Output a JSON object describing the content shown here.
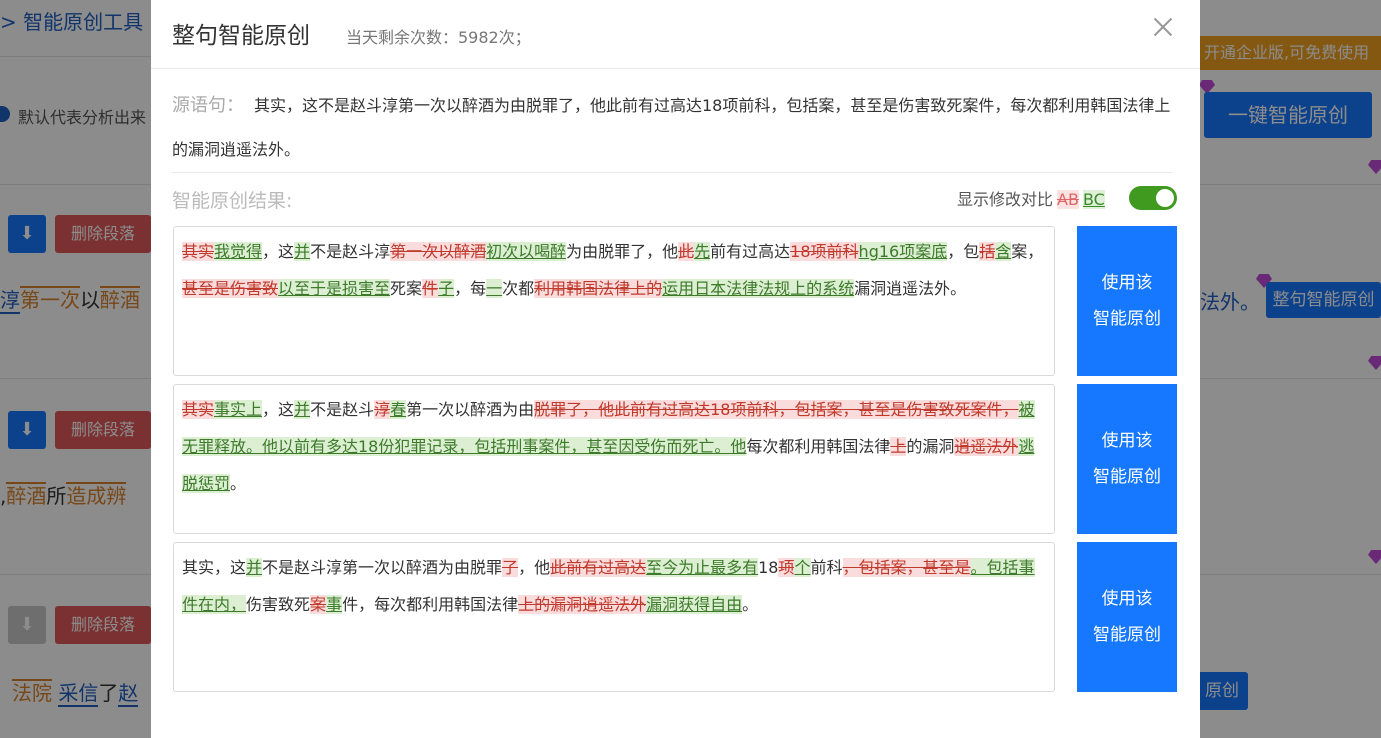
{
  "background": {
    "breadcrumb": "> 智能原创工具",
    "default_analysis": "默认代表分析出来",
    "promo_banner": "开通企业版,可免费使用",
    "one_click_button": "一键智能原创",
    "delete_paragraph": "删除段落",
    "whole_sentence_button": "整句智能原创",
    "row1_words": [
      "淳",
      "第一次",
      "以",
      "醉酒"
    ],
    "row1_right": "法外。",
    "row2_words": [
      ",",
      "醉酒",
      "所",
      "造成",
      "辨"
    ],
    "row3_words": [
      "法院",
      "采信",
      "了",
      "赵"
    ],
    "row3_button": "原创",
    "arrow_icon": "down-arrow-icon",
    "colors": {
      "primary": "#1677ff",
      "danger": "#e05a5a",
      "promo": "#f0a020"
    }
  },
  "modal": {
    "title": "整句智能原创",
    "remaining_label": "当天剩余次数：5982次；",
    "source_label": "源语句：",
    "source_text": "其实，这不是赵斗淳第一次以醉酒为由脱罪了，他此前有过高达18项前科，包括案，甚至是伤害致死案件，每次都利用韩国法律上的漏洞逍遥法外。",
    "result_label": "智能原创结果:",
    "toggle_label": "显示修改对比",
    "toggle_ab": "AB",
    "toggle_bc": "BC",
    "toggle_on": true,
    "use_button_line1": "使用该",
    "use_button_line2": "智能原创",
    "results": [
      [
        {
          "t": "其实",
          "k": "d"
        },
        {
          "t": "我觉得",
          "k": "a"
        },
        {
          "t": "，这",
          "k": ""
        },
        {
          "t": "并",
          "k": "a"
        },
        {
          "t": "不是赵斗淳",
          "k": ""
        },
        {
          "t": "第一次以醉酒",
          "k": "d"
        },
        {
          "t": "初次以喝醉",
          "k": "a"
        },
        {
          "t": "为由脱罪了，他",
          "k": ""
        },
        {
          "t": "此",
          "k": "d"
        },
        {
          "t": "先",
          "k": "a"
        },
        {
          "t": "前有过高达",
          "k": ""
        },
        {
          "t": "18项前科",
          "k": "d"
        },
        {
          "t": "hg16项案底",
          "k": "a"
        },
        {
          "t": "，包",
          "k": ""
        },
        {
          "t": "括",
          "k": "d"
        },
        {
          "t": "含",
          "k": "a"
        },
        {
          "t": "案，",
          "k": ""
        },
        {
          "t": "甚至是伤害致",
          "k": "d"
        },
        {
          "t": "以至于是损害至",
          "k": "a"
        },
        {
          "t": "死案",
          "k": ""
        },
        {
          "t": "件",
          "k": "d"
        },
        {
          "t": "子",
          "k": "a"
        },
        {
          "t": "，每",
          "k": ""
        },
        {
          "t": "一",
          "k": "a"
        },
        {
          "t": "次都",
          "k": ""
        },
        {
          "t": "利用韩国法律上的",
          "k": "d"
        },
        {
          "t": "运用日本法律法规上的系统",
          "k": "a"
        },
        {
          "t": "漏洞逍遥法外。",
          "k": ""
        }
      ],
      [
        {
          "t": "其实",
          "k": "d"
        },
        {
          "t": "事实上",
          "k": "a"
        },
        {
          "t": "，这",
          "k": ""
        },
        {
          "t": "并",
          "k": "a"
        },
        {
          "t": "不是赵斗",
          "k": ""
        },
        {
          "t": "淳",
          "k": "d"
        },
        {
          "t": "春",
          "k": "a"
        },
        {
          "t": "第一次以醉酒为由",
          "k": ""
        },
        {
          "t": "脱罪了，他此前有过高达18项前科，包括案，甚至是伤害致死案件，",
          "k": "d"
        },
        {
          "t": "被无罪释放。他以前有多达18份犯罪记录，包括刑事案件，甚至因受伤而死亡。他",
          "k": "a"
        },
        {
          "t": "每次都利用韩国法律",
          "k": ""
        },
        {
          "t": "上",
          "k": "d"
        },
        {
          "t": "的漏洞",
          "k": ""
        },
        {
          "t": "逍遥法外",
          "k": "d"
        },
        {
          "t": "逃脱惩罚",
          "k": "a"
        },
        {
          "t": "。",
          "k": ""
        }
      ],
      [
        {
          "t": "其实，这",
          "k": ""
        },
        {
          "t": "并",
          "k": "a"
        },
        {
          "t": "不是赵斗淳第一次以醉酒为由脱罪",
          "k": ""
        },
        {
          "t": "了",
          "k": "d"
        },
        {
          "t": "，他",
          "k": ""
        },
        {
          "t": "此前有过高达",
          "k": "d"
        },
        {
          "t": "至今为止最多有",
          "k": "a"
        },
        {
          "t": "18",
          "k": ""
        },
        {
          "t": "项",
          "k": "d"
        },
        {
          "t": "个",
          "k": "a"
        },
        {
          "t": "前科",
          "k": ""
        },
        {
          "t": "，包括案，甚至是",
          "k": "d"
        },
        {
          "t": "。包括事件在内，",
          "k": "a"
        },
        {
          "t": "伤害致死",
          "k": ""
        },
        {
          "t": "案",
          "k": "d"
        },
        {
          "t": "事",
          "k": "a"
        },
        {
          "t": "件，每次都利用韩国法律",
          "k": ""
        },
        {
          "t": "上的漏洞逍遥法外",
          "k": "d"
        },
        {
          "t": "漏洞获得自由",
          "k": "a"
        },
        {
          "t": "。",
          "k": ""
        }
      ]
    ]
  }
}
